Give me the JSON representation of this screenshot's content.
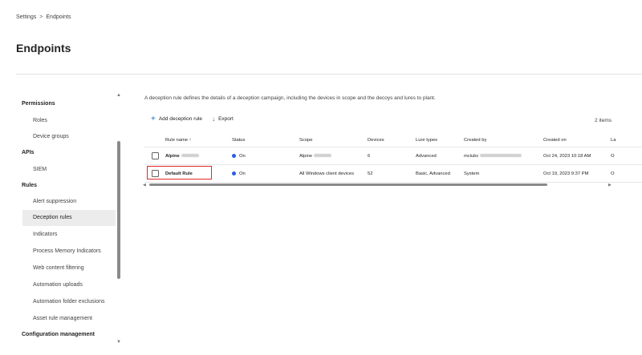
{
  "breadcrumb": {
    "parent": "Settings",
    "separator": ">",
    "current": "Endpoints"
  },
  "page_title": "Endpoints",
  "sidebar": {
    "sections": [
      {
        "title": "Permissions",
        "items": [
          "Roles",
          "Device groups"
        ]
      },
      {
        "title": "APIs",
        "items": [
          "SIEM"
        ]
      },
      {
        "title": "Rules",
        "items": [
          "Alert suppression",
          "Deception rules",
          "Indicators",
          "Process Memory Indicators",
          "Web content filtering",
          "Automation uploads",
          "Automation folder exclusions",
          "Asset rule management"
        ]
      },
      {
        "title": "Configuration management",
        "items": []
      }
    ],
    "selected_item": "Deception rules"
  },
  "main": {
    "description": "A deception rule defines the details of a deception campaign, including the devices in scope and the decoys and lures to plant.",
    "toolbar": {
      "add_label": "Add deception rule",
      "export_label": "Export"
    },
    "item_count": "2 items",
    "table": {
      "columns": [
        "Rule name",
        "Status",
        "Scope",
        "Devices",
        "Lure types",
        "Created by",
        "Created on",
        "La"
      ],
      "sort_indicator": "↑",
      "rows": [
        {
          "name": "Alpine",
          "status": "On",
          "scope": "Alpine",
          "devices": "6",
          "lure_types": "Advanced",
          "created_by": "mciubc",
          "created_on": "Oct 24, 2023 10:18 AM",
          "last": "O"
        },
        {
          "name": "Default Rule",
          "status": "On",
          "scope": "All Windows client devices",
          "devices": "52",
          "lure_types": "Basic, Advanced",
          "created_by": "System",
          "created_on": "Oct 19, 2023 9:37 PM",
          "last": "O"
        }
      ]
    }
  },
  "colors": {
    "accent": "#0f6cbd",
    "status_on": "#2b5ce6",
    "highlight": "#e0292a",
    "selected_bg": "#ececec"
  }
}
